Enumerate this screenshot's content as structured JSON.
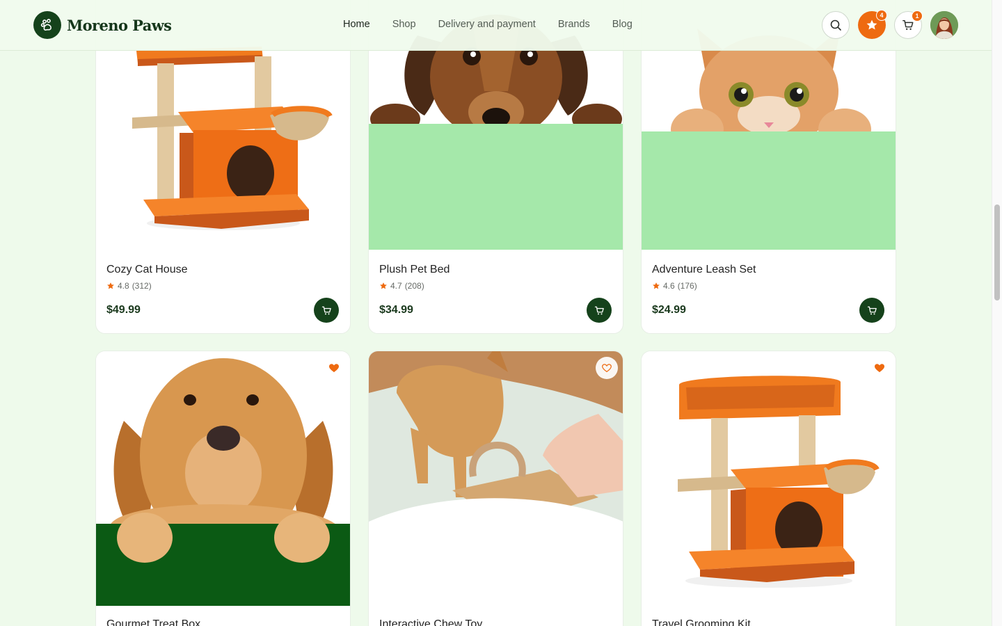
{
  "brand": {
    "name": "Moreno Paws",
    "logo_icon": "paw-icon"
  },
  "nav": {
    "items": [
      {
        "label": "Home",
        "active": true
      },
      {
        "label": "Shop",
        "active": false
      },
      {
        "label": "Delivery and payment",
        "active": false
      },
      {
        "label": "Brands",
        "active": false
      },
      {
        "label": "Blog",
        "active": false
      }
    ]
  },
  "header_actions": {
    "search_icon": "search-icon",
    "favorites_count": "4",
    "cart_count": "1",
    "avatar": "user-avatar"
  },
  "colors": {
    "primary_green": "#15421b",
    "accent_orange": "#ee6a10",
    "page_background": "#eefaeb",
    "mint": "#a5e8aa"
  },
  "products": [
    {
      "name": "Cozy Cat House",
      "rating": "4.8",
      "reviews": "(312)",
      "price": "$49.99",
      "favorited": false
    },
    {
      "name": "Plush Pet Bed",
      "rating": "4.7",
      "reviews": "(208)",
      "price": "$34.99",
      "favorited": false
    },
    {
      "name": "Adventure Leash Set",
      "rating": "4.6",
      "reviews": "(176)",
      "price": "$24.99",
      "favorited": false
    },
    {
      "name": "Gourmet Treat Box",
      "favorited": true
    },
    {
      "name": "Interactive Chew Toy",
      "favorited": false
    },
    {
      "name": "Travel Grooming Kit",
      "favorited": true
    }
  ]
}
